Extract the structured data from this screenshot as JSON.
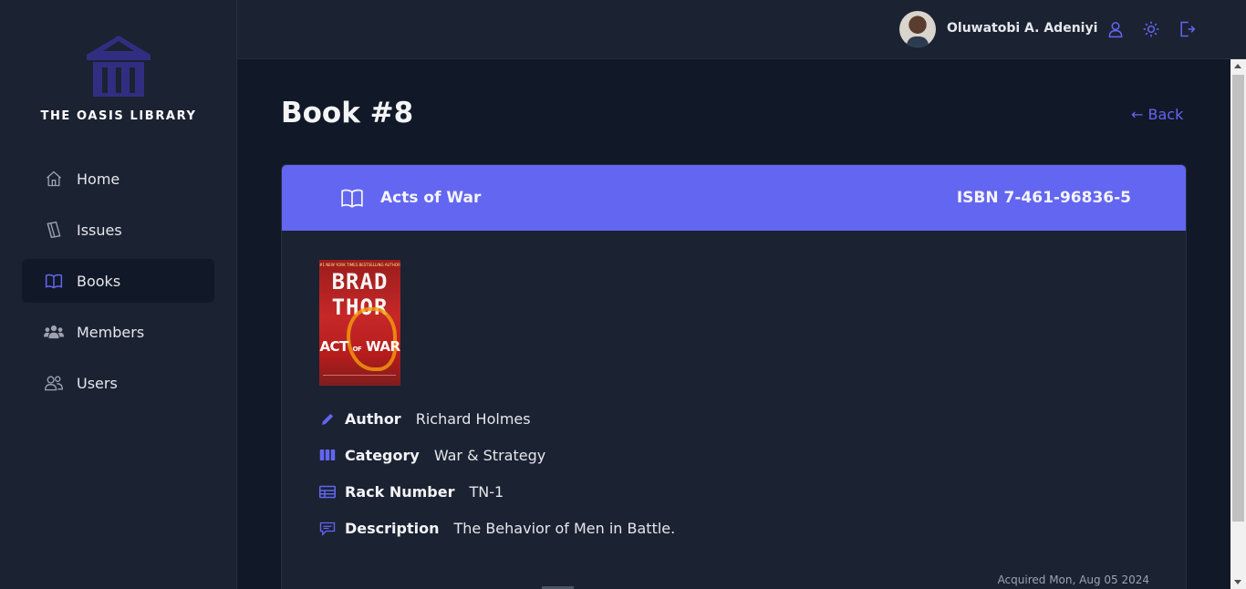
{
  "app": {
    "logo_text": "THE OASIS LIBRARY"
  },
  "sidebar": {
    "items": [
      {
        "label": "Home",
        "icon": "home-icon",
        "active": false
      },
      {
        "label": "Issues",
        "icon": "issues-book-icon",
        "active": false
      },
      {
        "label": "Books",
        "icon": "open-book-icon",
        "active": true
      },
      {
        "label": "Members",
        "icon": "members-group-icon",
        "active": false
      },
      {
        "label": "Users",
        "icon": "users-icon",
        "active": false
      }
    ]
  },
  "topbar": {
    "user_name": "Oluwatobi A. Adeniyi",
    "icons": [
      "profile-icon",
      "theme-sun-icon",
      "logout-icon"
    ]
  },
  "page": {
    "title": "Book #8",
    "back_label": "← Back"
  },
  "book": {
    "title": "Acts of War",
    "isbn": "ISBN 7-461-96836-5",
    "cover": {
      "tagline": "#1 NEW YORK TIMES BESTSELLING AUTHOR",
      "author_text": "BRAD THOR",
      "title_text_main": "ACT",
      "title_text_of": "OF",
      "title_text_end": "WAR"
    },
    "details": [
      {
        "label": "Author",
        "value": "Richard Holmes",
        "icon": "pencil-icon"
      },
      {
        "label": "Category",
        "value": "War & Strategy",
        "icon": "columns-icon"
      },
      {
        "label": "Rack Number",
        "value": "TN-1",
        "icon": "table-icon"
      },
      {
        "label": "Description",
        "value": "The Behavior of Men in Battle.",
        "icon": "comment-icon"
      }
    ],
    "acquired": "Acquired Mon, Aug 05 2024"
  },
  "colors": {
    "accent": "#6366f1",
    "background": "#111827",
    "panel": "#1b2232",
    "logo": "#312e81"
  }
}
